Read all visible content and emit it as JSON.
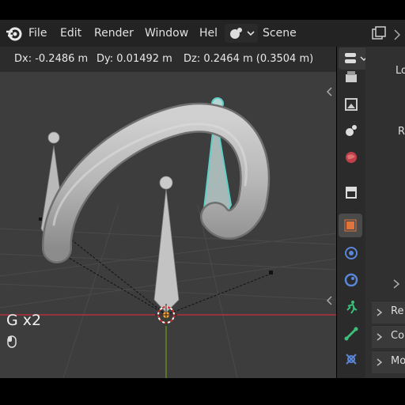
{
  "menu": {
    "file": "File",
    "edit": "Edit",
    "render": "Render",
    "window": "Window",
    "help": "Hel",
    "scene": "Scene"
  },
  "header": {
    "dx": "Dx: -0.2486 m",
    "dy": "Dy: 0.01492 m",
    "dz": "Dz: 0.2464 m (0.3504 m)"
  },
  "operator": {
    "label": "G x2"
  },
  "properties": {
    "partial_labels": [
      "Lo",
      "R"
    ],
    "panels": [
      "Re",
      "Co",
      "Mo"
    ]
  },
  "colors": {
    "viewport_bg": "#3d3d3d",
    "x_axis": "#b4313f",
    "y_axis": "#5e8b22",
    "selection": "#5fd0c8",
    "active_icon": "#e0743c"
  }
}
